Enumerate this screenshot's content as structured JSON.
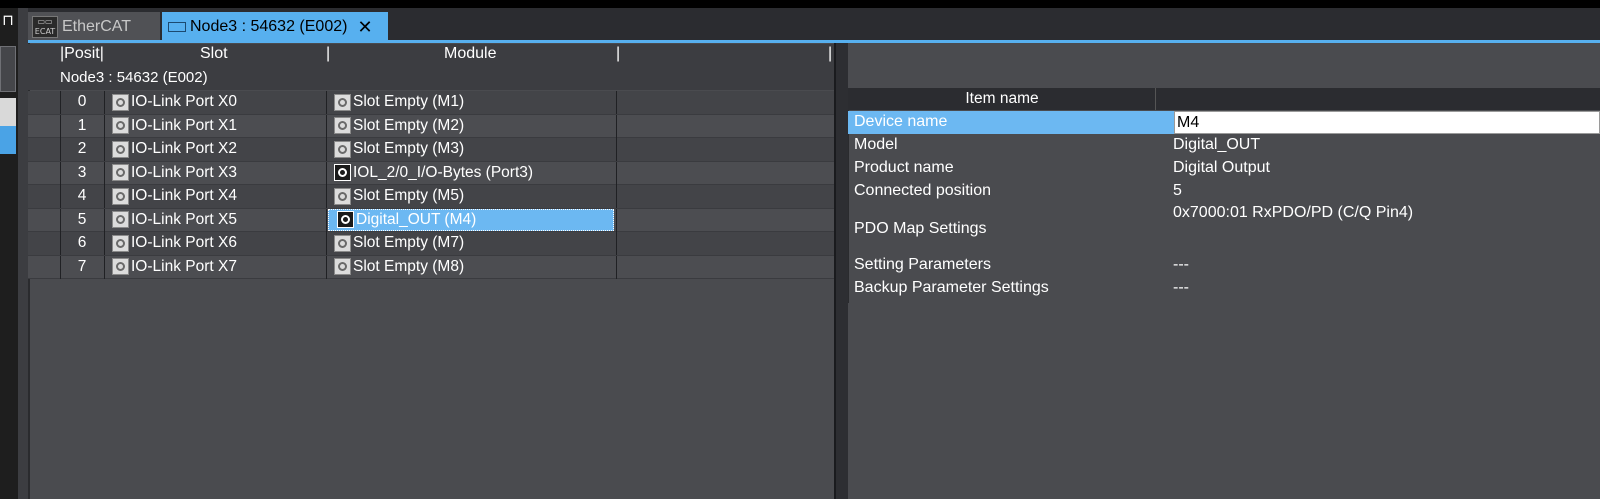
{
  "tabs": [
    {
      "label": "EtherCAT",
      "icon": "ecat-icon"
    },
    {
      "label": "Node3 : 54632 (E002)",
      "icon": "node-icon",
      "close": "✕"
    }
  ],
  "left_pane": {
    "columns": [
      "Posit",
      "Slot",
      "Module"
    ],
    "node_title": "Node3 : 54632 (E002)",
    "rows": [
      {
        "pos": "0",
        "slot": "IO-Link Port X0",
        "module": "Slot Empty (M1)"
      },
      {
        "pos": "1",
        "slot": "IO-Link Port X1",
        "module": "Slot Empty (M2)"
      },
      {
        "pos": "2",
        "slot": "IO-Link Port X2",
        "module": "Slot Empty (M3)"
      },
      {
        "pos": "3",
        "slot": "IO-Link Port X3",
        "module": "IOL_2/0_I/O-Bytes (Port3)"
      },
      {
        "pos": "4",
        "slot": "IO-Link Port X4",
        "module": "Slot Empty (M5)"
      },
      {
        "pos": "5",
        "slot": "IO-Link Port X5",
        "module": "Digital_OUT (M4)"
      },
      {
        "pos": "6",
        "slot": "IO-Link Port X6",
        "module": "Slot Empty (M7)"
      },
      {
        "pos": "7",
        "slot": "IO-Link Port X7",
        "module": "Slot Empty (M8)"
      }
    ],
    "selected_row": 5
  },
  "right_pane": {
    "header": "Item name",
    "device_name_label": "Device name",
    "device_name_value": "M4",
    "properties": [
      {
        "key": "Model",
        "value": "Digital_OUT"
      },
      {
        "key": "Product name",
        "value": "Digital Output"
      },
      {
        "key": "Connected position",
        "value": "5"
      },
      {
        "key": "PDO Map Settings",
        "value": "0x7000:01 RxPDO/PD (C/Q Pin4)"
      },
      {
        "key": "Setting Parameters",
        "value": "---"
      },
      {
        "key": "Backup Parameter Settings",
        "value": "---"
      }
    ]
  },
  "colors": {
    "accent": "#57b0ef",
    "selection": "#6cb8f2",
    "background": "#4a4b4f"
  }
}
